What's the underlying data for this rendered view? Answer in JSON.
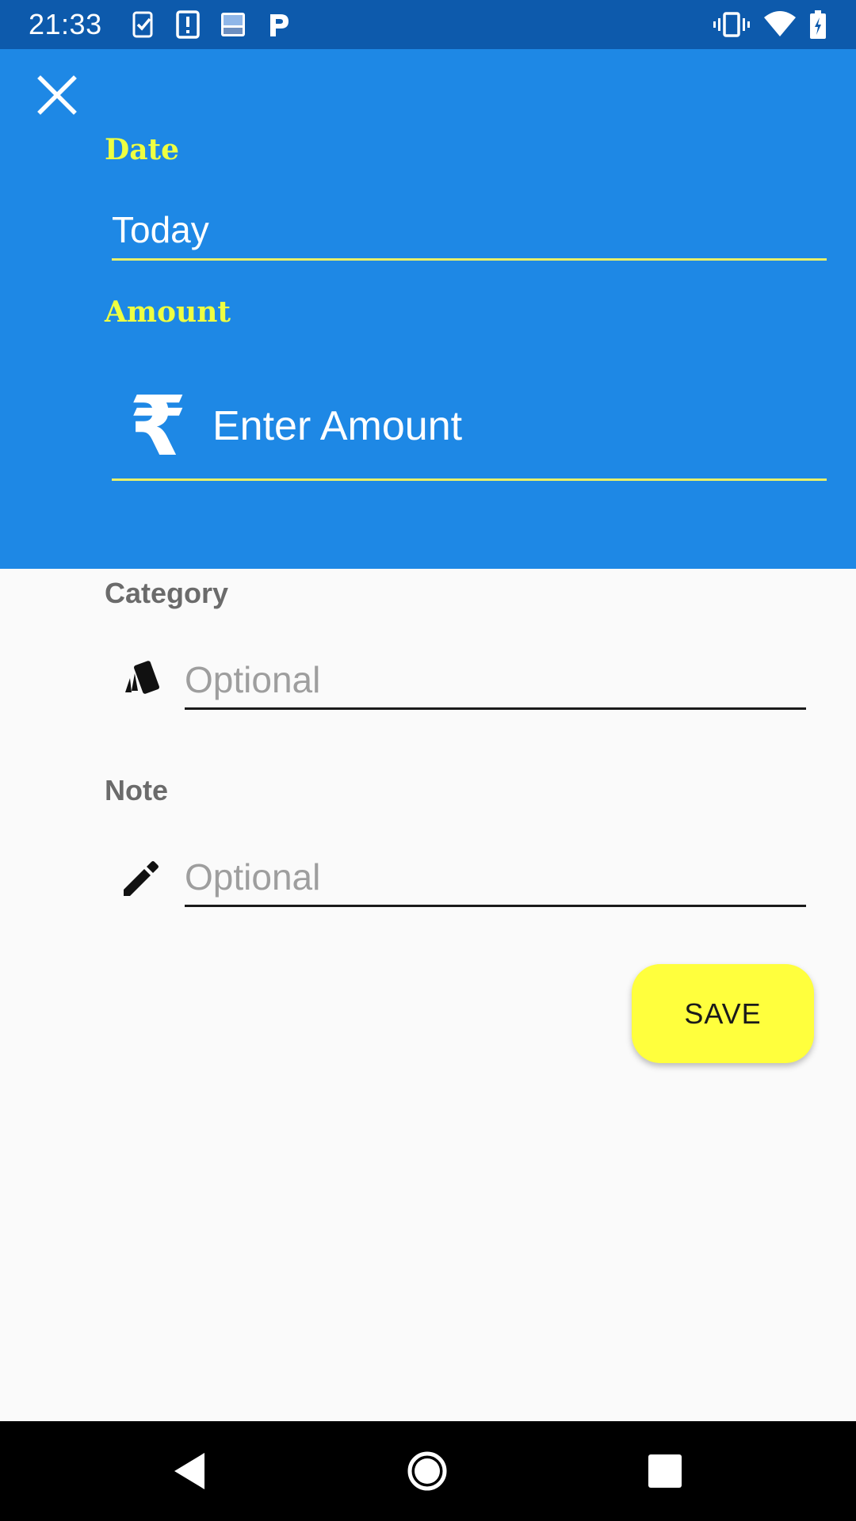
{
  "status_bar": {
    "time": "21:33",
    "left_icons": [
      "task-check-icon",
      "alert-notification-icon",
      "app-notification-icon",
      "parking-icon"
    ],
    "right_icons": [
      "vibrate-icon",
      "wifi-icon",
      "battery-icon"
    ]
  },
  "colors": {
    "status_bar": "#0d5aac",
    "header": "#1e88e5",
    "accent_yellow": "#eeff41",
    "save_button": "#ffff3d",
    "background": "#fafafa"
  },
  "header": {
    "close_icon": "close-icon",
    "date_label": "Date",
    "date_value": "Today",
    "amount_label": "Amount",
    "currency_symbol": "₹",
    "amount_placeholder": "Enter Amount"
  },
  "form": {
    "category_label": "Category",
    "category_icon": "cards-icon",
    "category_placeholder": "Optional",
    "note_label": "Note",
    "note_icon": "pencil-icon",
    "note_placeholder": "Optional",
    "save_label": "SAVE"
  },
  "nav_bar": {
    "icons": [
      "back-icon",
      "home-icon",
      "recents-icon"
    ]
  }
}
